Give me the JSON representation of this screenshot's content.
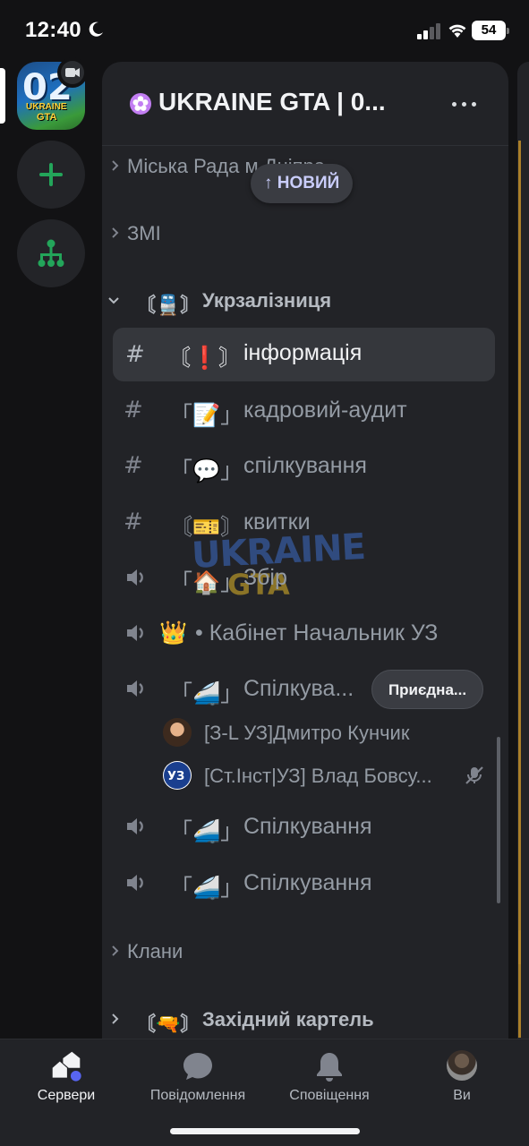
{
  "status_bar": {
    "time": "12:40",
    "battery": "54"
  },
  "guild": {
    "name": "UKRAINE GTA | 0...",
    "avatar_text_big": "02",
    "avatar_text_small": "UKRAINE",
    "avatar_text_small2": "GTA"
  },
  "new_pill": "↑ НОВИЙ",
  "categories": {
    "city_council": "Міська Рада м.Дніпра",
    "media": "ЗМІ",
    "ukrzaliznytsia": "Укрзалізниця",
    "ukrzaliznytsia_prefix": "〘🚆〙",
    "clans": "Клани",
    "western_cartel": "Західний картель",
    "western_cartel_prefix": "〘🔫〙"
  },
  "channels": [
    {
      "prefix": "〘❗〙",
      "label": "інформація",
      "type": "text"
    },
    {
      "prefix": "「📝」",
      "label": "кадровий-аудит",
      "type": "text"
    },
    {
      "prefix": "「💬」",
      "label": "спілкування",
      "type": "text"
    },
    {
      "prefix": "〘🎫〙",
      "label": "квитки",
      "type": "text"
    },
    {
      "prefix": "「🏠」",
      "label": "Збір",
      "type": "voice"
    },
    {
      "prefix": "👑",
      "label": "• Кабінет Начальник УЗ",
      "type": "voice"
    },
    {
      "prefix": "「🚄」",
      "label": "Спілкува...",
      "type": "voice"
    },
    {
      "prefix": "「🚄」",
      "label": "Спілкування",
      "type": "voice"
    },
    {
      "prefix": "「🚄」",
      "label": "Спілкування",
      "type": "voice"
    }
  ],
  "join_button": "Приєдна...",
  "voice_members": [
    {
      "name": "[З-L УЗ]Дмитро Кунчик"
    },
    {
      "name": "[Ст.Інст|УЗ] Влад Бовсу...",
      "muted": true
    }
  ],
  "watermark": {
    "line1": "UKRAINE",
    "line2": "GTA"
  },
  "nav": [
    {
      "label": "Сервери",
      "icon": "servers-icon",
      "active": true
    },
    {
      "label": "Повідомлення",
      "icon": "messages-icon",
      "active": false
    },
    {
      "label": "Сповіщення",
      "icon": "bell-icon",
      "active": false
    },
    {
      "label": "Ви",
      "icon": "profile-avatar",
      "active": false
    }
  ],
  "colors": {
    "background": "#121214",
    "panel": "#222327",
    "accent_green": "#23a55a",
    "accent_blurple": "#5865f2"
  }
}
